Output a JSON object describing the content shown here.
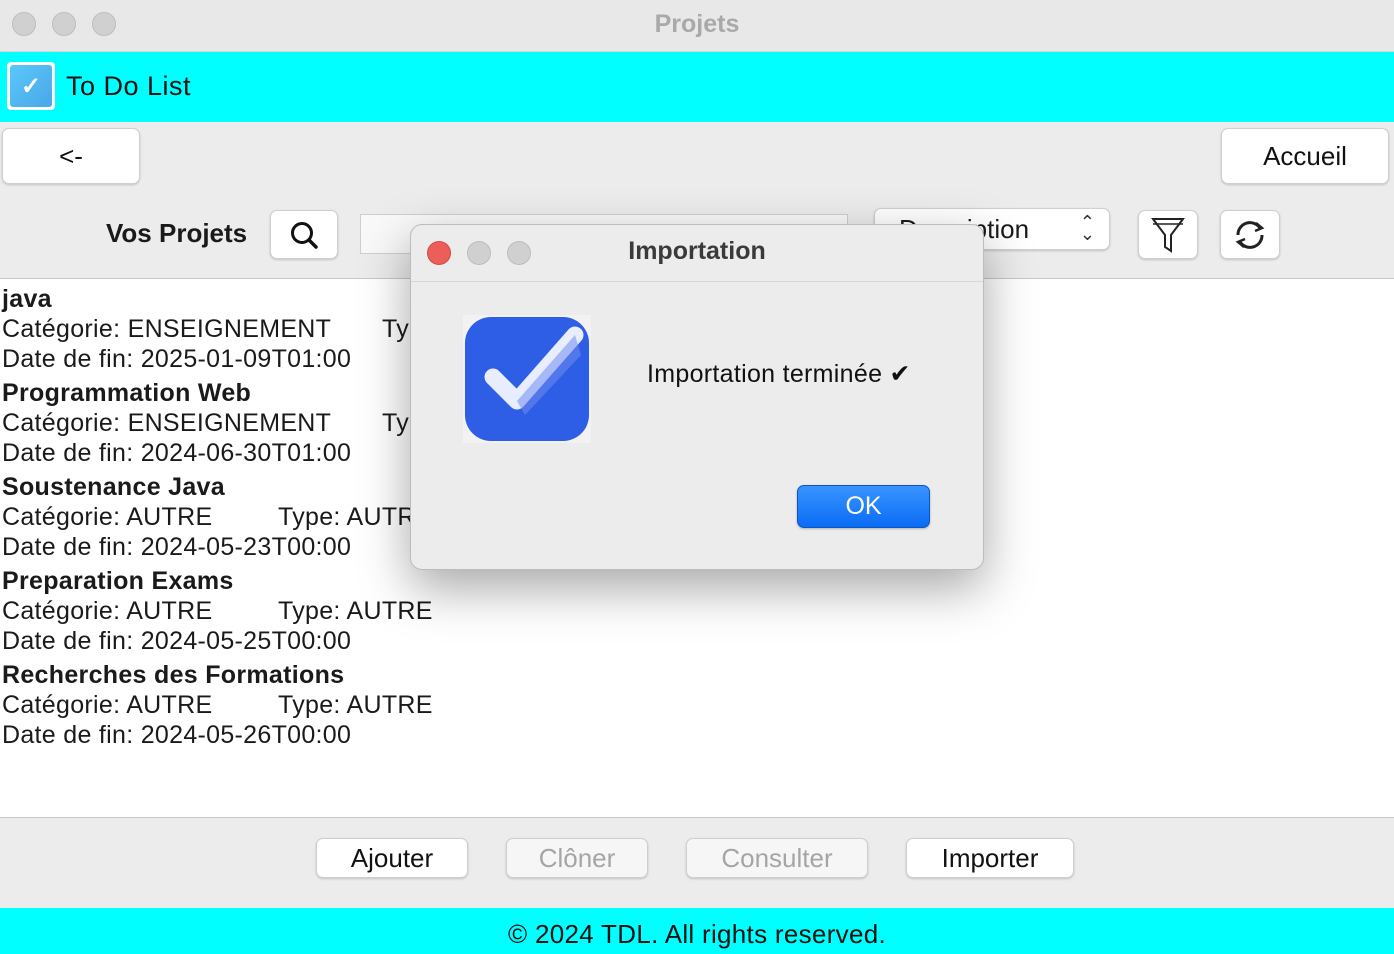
{
  "window": {
    "title": "Projets"
  },
  "header": {
    "app_title": "To Do List"
  },
  "toolbar": {
    "back_label": "<-",
    "home_label": "Accueil",
    "section_label": "Vos Projets",
    "sort_selected": "Description",
    "search_value": ""
  },
  "projects": [
    {
      "name": "java",
      "category": "Catégorie: ENSEIGNEMENT",
      "type": "Type: ENSEIGNEMENT",
      "end_date": "Date de fin: 2025-01-09T01:00"
    },
    {
      "name": "Programmation Web",
      "category": "Catégorie: ENSEIGNEMENT",
      "type": "Type: ENSEIGNEMENT",
      "end_date": "Date de fin: 2024-06-30T01:00"
    },
    {
      "name": "Soustenance Java",
      "category": "Catégorie: AUTRE",
      "type": "Type: AUTRE",
      "end_date": "Date de fin: 2024-05-23T00:00"
    },
    {
      "name": "Preparation Exams",
      "category": "Catégorie: AUTRE",
      "type": "Type: AUTRE",
      "end_date": "Date de fin: 2024-05-25T00:00"
    },
    {
      "name": "Recherches des Formations",
      "category": "Catégorie: AUTRE",
      "type": "Type: AUTRE",
      "end_date": "Date de fin: 2024-05-26T00:00"
    }
  ],
  "actions": {
    "add_label": "Ajouter",
    "clone_label": "Clôner",
    "view_label": "Consulter",
    "import_label": "Importer"
  },
  "footer": {
    "text": "© 2024 TDL. All rights reserved."
  },
  "dialog": {
    "title": "Importation",
    "message": "Importation terminée ✔",
    "ok_label": "OK"
  },
  "colors": {
    "accent_cyan": "#00ffff",
    "ok_blue": "#0a6cf5",
    "icon_blue": "#2f5ee6",
    "close_red": "#ec5f59"
  },
  "icons": {
    "search": "magnifier-icon",
    "filter": "funnel-icon",
    "refresh": "refresh-icon",
    "app": "checkbox-icon"
  }
}
